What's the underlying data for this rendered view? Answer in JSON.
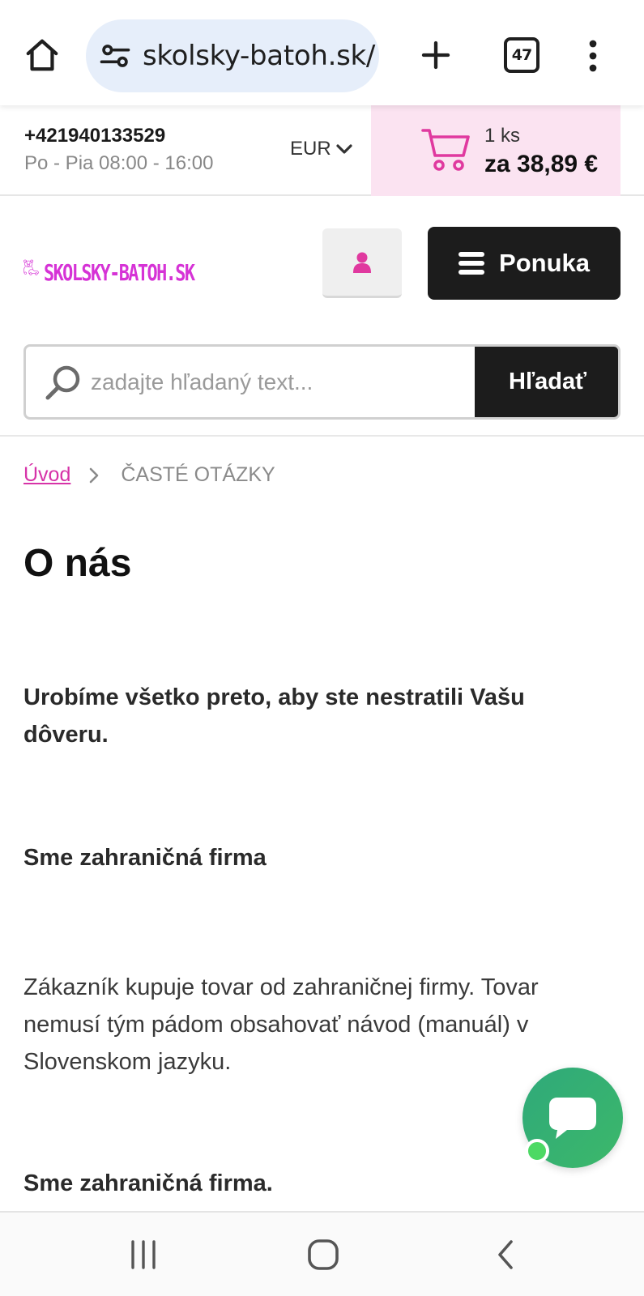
{
  "browser": {
    "url": "skolsky-batoh.sk/",
    "tab_count": "47"
  },
  "topbar": {
    "phone": "+421940133529",
    "hours": "Po - Pia 08:00 - 16:00",
    "currency": "EUR",
    "cart_qty": "1 ks",
    "cart_total": "za 38,89 €"
  },
  "header": {
    "logo_text": "SKOLSKY-BATOH.SK",
    "menu_label": "Ponuka"
  },
  "search": {
    "placeholder": "zadajte hľadaný text...",
    "button_label": "Hľadať"
  },
  "breadcrumb": {
    "home": "Úvod",
    "current": "ČASTÉ OTÁZKY"
  },
  "content": {
    "title": "O nás",
    "p1": "Urobíme všetko preto, aby ste nestratili Vašu dôveru.",
    "p2": "Sme zahraničná firma",
    "p3": "Zákazník kupuje tovar od zahraničnej firmy. Tovar nemusí tým pádom obsahovať návod (manuál) v Slovenskom jazyku.",
    "p4": "Sme zahraničná firma."
  },
  "colors": {
    "accent_pink": "#d633d6",
    "cart_bg": "#fbe3f1",
    "dark_button": "#1c1c1c",
    "chat_green": "#34b072"
  },
  "icons": [
    "home-icon",
    "site-settings-icon",
    "new-tab-icon",
    "tab-switcher-icon",
    "more-options-icon",
    "chevron-down-icon",
    "cart-icon",
    "bear-car-logo-icon",
    "user-icon",
    "hamburger-icon",
    "search-icon",
    "chevron-right-icon",
    "chat-icon",
    "recent-apps-icon",
    "android-home-icon",
    "android-back-icon"
  ]
}
